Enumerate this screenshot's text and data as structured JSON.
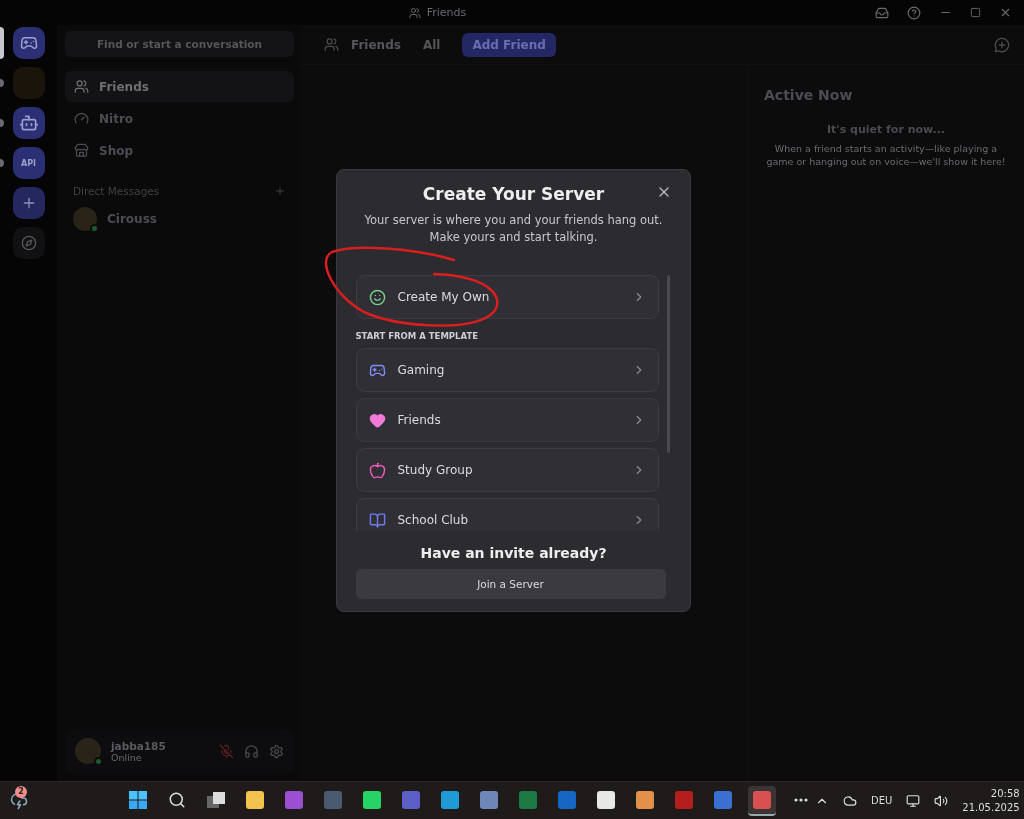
{
  "window": {
    "title": "Friends"
  },
  "servers": [
    {
      "kind": "home",
      "selected": true,
      "unread": false
    },
    {
      "kind": "image",
      "selected": false,
      "unread": true
    },
    {
      "kind": "bot",
      "selected": false,
      "unread": true
    },
    {
      "kind": "api",
      "label": "API",
      "selected": false,
      "unread": true
    },
    {
      "kind": "add",
      "selected": false,
      "unread": false
    },
    {
      "kind": "explore",
      "selected": false,
      "unread": false
    }
  ],
  "search": {
    "placeholder": "Find or start a conversation"
  },
  "nav": [
    {
      "kind": "friends",
      "label": "Friends",
      "selected": true
    },
    {
      "kind": "nitro",
      "label": "Nitro",
      "selected": false
    },
    {
      "kind": "shop",
      "label": "Shop",
      "selected": false
    }
  ],
  "direct_messages": {
    "heading": "Direct Messages",
    "items": [
      {
        "name": "Cirouss"
      }
    ]
  },
  "user": {
    "name": "jabba185",
    "status": "Online"
  },
  "header": {
    "title": "Friends",
    "tabs": [
      {
        "kind": "tab",
        "label": "All",
        "selected": false
      },
      {
        "kind": "action",
        "label": "Add Friend",
        "selected": false
      }
    ]
  },
  "active_now": {
    "title": "Active Now",
    "empty_title": "It's quiet for now...",
    "empty_text": "When a friend starts an activity—like playing a game or hanging out on voice—we'll show it here!"
  },
  "modal": {
    "title": "Create Your Server",
    "subtitle": "Your server is where you and your friends hang out. Make yours and start talking.",
    "first_option": {
      "kind": "own",
      "label": "Create My Own"
    },
    "template_heading": "START FROM A TEMPLATE",
    "templates": [
      {
        "kind": "gaming",
        "label": "Gaming"
      },
      {
        "kind": "friends",
        "label": "Friends"
      },
      {
        "kind": "study",
        "label": "Study Group"
      },
      {
        "kind": "school",
        "label": "School Club"
      }
    ],
    "invite_heading": "Have an invite already?",
    "join_button": "Join a Server"
  },
  "taskbar": {
    "weather_badge": "2",
    "apps": [
      {
        "kind": "start",
        "selected": false
      },
      {
        "kind": "search",
        "selected": false
      },
      {
        "kind": "taskview",
        "selected": false
      },
      {
        "kind": "tile",
        "color": "#f2c14e",
        "selected": false
      },
      {
        "kind": "tile",
        "color": "#9b4fd1",
        "selected": false
      },
      {
        "kind": "tile",
        "color": "#4a5a70",
        "selected": false
      },
      {
        "kind": "tile",
        "color": "#25d366",
        "selected": false
      },
      {
        "kind": "tile",
        "color": "#5b5fc7",
        "selected": false
      },
      {
        "kind": "tile",
        "color": "#1e9bd7",
        "selected": false
      },
      {
        "kind": "tile",
        "color": "#6d87b8",
        "selected": false
      },
      {
        "kind": "tile",
        "color": "#1d7a45",
        "selected": false
      },
      {
        "kind": "tile",
        "color": "#1667c4",
        "selected": false
      },
      {
        "kind": "tile",
        "color": "#e8e8e8",
        "selected": false
      },
      {
        "kind": "tile",
        "color": "#e3914a",
        "selected": false
      },
      {
        "kind": "tile",
        "color": "#b41e1e",
        "selected": false
      },
      {
        "kind": "tile",
        "color": "#3b6fd0",
        "selected": false
      },
      {
        "kind": "tile",
        "color": "#d85050",
        "selected": true
      },
      {
        "kind": "more",
        "selected": false
      }
    ],
    "language": "DEU",
    "time": "20:58",
    "date": "21.05.2025"
  }
}
